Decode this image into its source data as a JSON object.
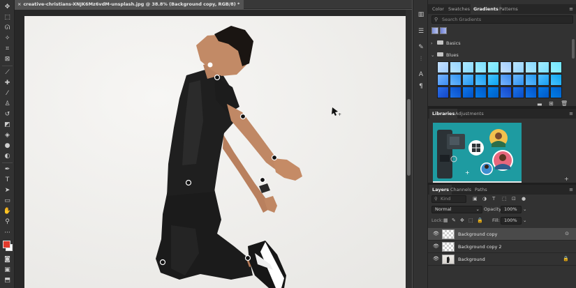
{
  "document": {
    "tab_close": "×",
    "tab_title": "creative-christians-XNJK6Mz6vdM-unsplash.jpg @ 38.8% (Background copy, RGB/8) *"
  },
  "colors": {
    "foreground": "#e23a2c",
    "background": "#ffffff",
    "panel_bg": "#323232",
    "selected_layer": "#4a4a4a"
  },
  "toolbar": {
    "icons": [
      "move-icon",
      "marquee-icon",
      "lasso-icon",
      "magic-wand-icon",
      "crop-icon",
      "frame-icon",
      "eyedropper-icon",
      "healing-brush-icon",
      "brush-icon",
      "clone-stamp-icon",
      "history-brush-icon",
      "eraser-icon",
      "paint-bucket-icon",
      "blur-icon",
      "dodge-icon",
      "pen-icon",
      "type-icon",
      "path-selection-icon",
      "rectangle-icon",
      "hand-icon",
      "zoom-icon",
      "more-icon"
    ]
  },
  "top_panel": {
    "tabs": [
      "Color",
      "Swatches",
      "Gradients",
      "Patterns"
    ],
    "active_tab": "Gradients",
    "menu": "≡",
    "search_placeholder": "Search Gradients",
    "folders": [
      {
        "chevron": "›",
        "label": "Basics"
      },
      {
        "chevron": "⌄",
        "label": "Blues"
      }
    ]
  },
  "libraries_panel": {
    "tabs": [
      "Libraries",
      "Adjustments"
    ],
    "active_tab": "Libraries",
    "menu": "≡"
  },
  "layers_panel": {
    "tabs": [
      "Layers",
      "Channels",
      "Paths"
    ],
    "active_tab": "Layers",
    "menu": "≡",
    "filter_placeholder": "Kind",
    "blend_mode": "Normal",
    "opacity_label": "Opacity:",
    "opacity_value": "100%",
    "lock_label": "Lock:",
    "fill_label": "Fill:",
    "fill_value": "100%",
    "layers": [
      {
        "name": "Background copy",
        "selected": true,
        "thumb": "checker"
      },
      {
        "name": "Background copy 2",
        "selected": false,
        "thumb": "checker"
      },
      {
        "name": "Background",
        "selected": false,
        "thumb": "photo"
      }
    ]
  }
}
